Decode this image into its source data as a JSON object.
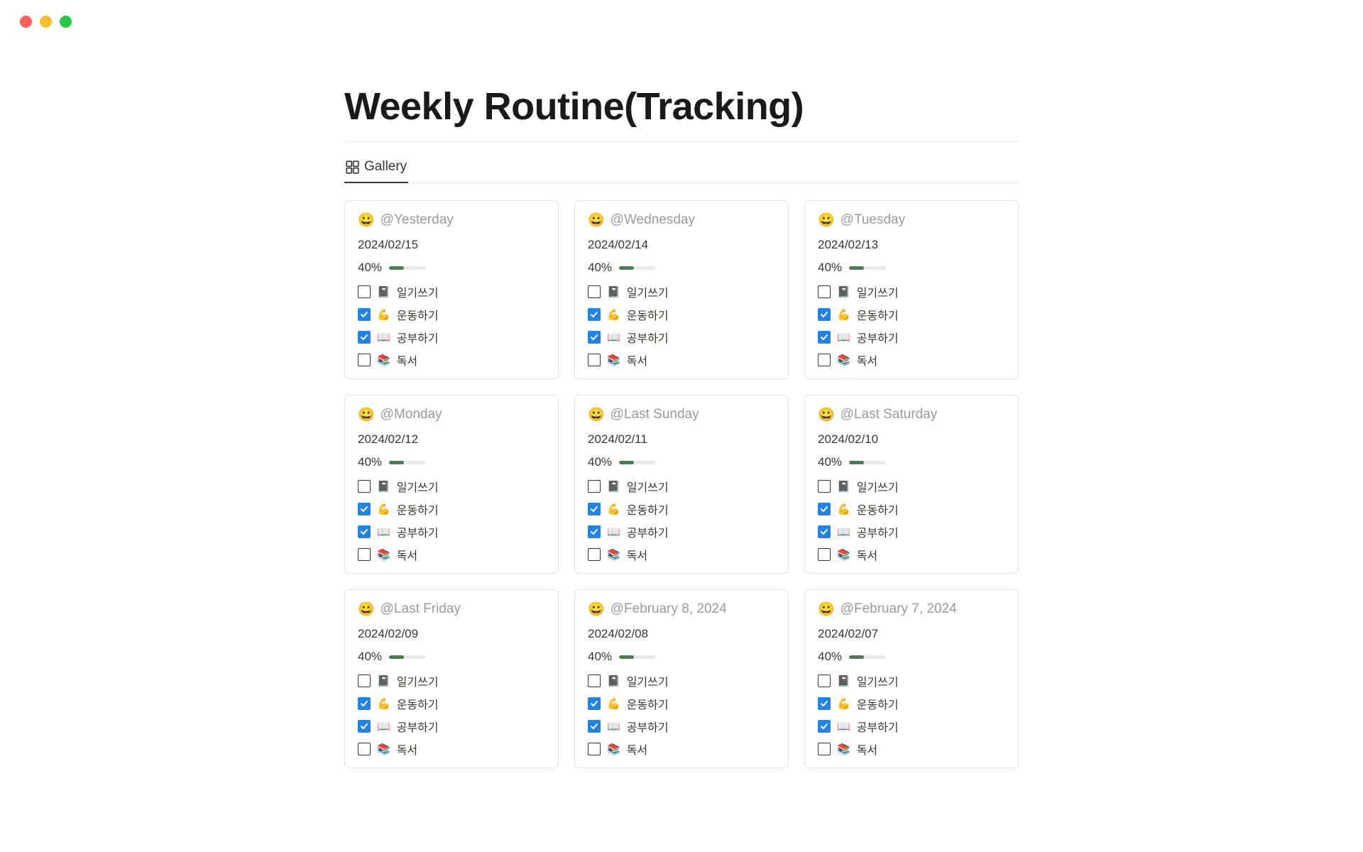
{
  "page": {
    "title": "Weekly Routine(Tracking)"
  },
  "view": {
    "tab_label": "Gallery"
  },
  "card_emoji": "😀",
  "tasks_template": [
    {
      "emoji": "📓",
      "label": "일기쓰기"
    },
    {
      "emoji": "💪",
      "label": "운동하기"
    },
    {
      "emoji": "📖",
      "label": "공부하기"
    },
    {
      "emoji": "📚",
      "label": "독서"
    }
  ],
  "cards": [
    {
      "relative": "@Yesterday",
      "date": "2024/02/15",
      "percent": "40%",
      "checked": [
        false,
        true,
        true,
        false
      ]
    },
    {
      "relative": "@Wednesday",
      "date": "2024/02/14",
      "percent": "40%",
      "checked": [
        false,
        true,
        true,
        false
      ]
    },
    {
      "relative": "@Tuesday",
      "date": "2024/02/13",
      "percent": "40%",
      "checked": [
        false,
        true,
        true,
        false
      ]
    },
    {
      "relative": "@Monday",
      "date": "2024/02/12",
      "percent": "40%",
      "checked": [
        false,
        true,
        true,
        false
      ]
    },
    {
      "relative": "@Last Sunday",
      "date": "2024/02/11",
      "percent": "40%",
      "checked": [
        false,
        true,
        true,
        false
      ]
    },
    {
      "relative": "@Last Saturday",
      "date": "2024/02/10",
      "percent": "40%",
      "checked": [
        false,
        true,
        true,
        false
      ]
    },
    {
      "relative": "@Last Friday",
      "date": "2024/02/09",
      "percent": "40%",
      "checked": [
        false,
        true,
        true,
        false
      ]
    },
    {
      "relative": "@February 8, 2024",
      "date": "2024/02/08",
      "percent": "40%",
      "checked": [
        false,
        true,
        true,
        false
      ]
    },
    {
      "relative": "@February 7, 2024",
      "date": "2024/02/07",
      "percent": "40%",
      "checked": [
        false,
        true,
        true,
        false
      ]
    }
  ]
}
